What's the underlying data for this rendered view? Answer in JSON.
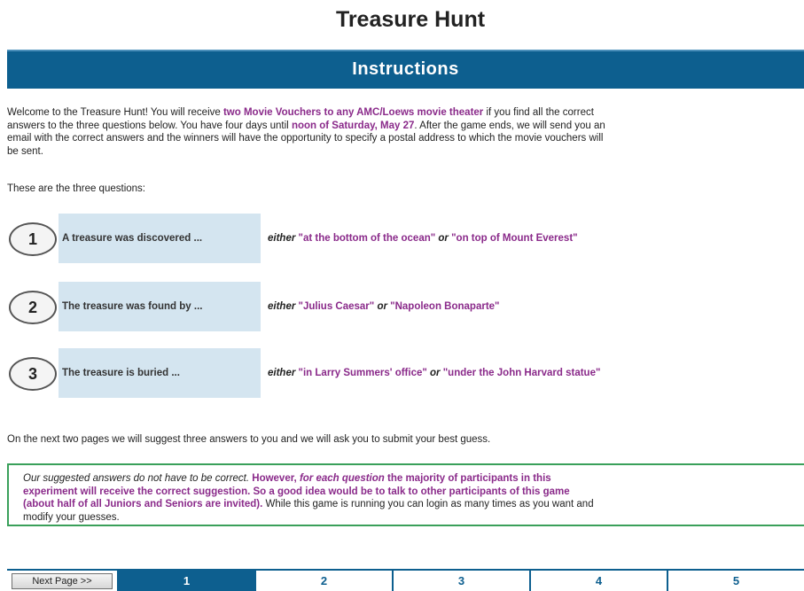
{
  "page_title": "Treasure Hunt",
  "instructions_header": "Instructions",
  "intro": {
    "l1_a": "Welcome to the Treasure Hunt! You will receive ",
    "l1_b": "two Movie Vouchers to any AMC/Loews movie theater",
    "l1_c": " if you find all the correct",
    "l2_a": "answers to the three questions below. You have four days until ",
    "l2_b": "noon of Saturday, May 27",
    "l2_c": ". After the game ends, we will send you an",
    "l3": "email with the correct answers and the winners will have the opportunity to specify a postal address to which the movie vouchers will",
    "l4": "be sent."
  },
  "questions_intro": "These are the three questions:",
  "either_label": "either",
  "or_label": "or",
  "questions": [
    {
      "number": "1",
      "text": "A treasure was discovered ...",
      "option_a": "\"at the bottom of the ocean\"",
      "option_b": "\"on top of Mount Everest\""
    },
    {
      "number": "2",
      "text": "The treasure was found by ...",
      "option_a": "\"Julius Caesar\"",
      "option_b": "\"Napoleon Bonaparte\""
    },
    {
      "number": "3",
      "text": "The treasure is buried ...",
      "option_a": "\"in Larry Summers' office\"",
      "option_b": "\"under the John Harvard statue\""
    }
  ],
  "next_pages_text": "On the next two pages we will suggest three answers to you and we will ask you to submit your best guess.",
  "notice": {
    "l1_a": "Our suggested answers do not have to be correct.",
    "l1_b": " However, ",
    "l1_c": "for each question",
    "l1_d": " the majority of participants in this",
    "l2": "experiment will receive the correct suggestion. So a good idea would be to talk to other participants of this game",
    "l3_a": "(about half of all Juniors and Seniors are invited).",
    "l3_b": " While this game is running you can login as many times as you want and",
    "l4": "modify your guesses."
  },
  "pager": {
    "next_button": "Next Page >>",
    "pages": [
      "1",
      "2",
      "3",
      "4",
      "5"
    ],
    "active_page": "1"
  },
  "colors": {
    "header_blue": "#0d5f8f",
    "question_box": "#d4e5f0",
    "highlight_purple": "#8a2a8a",
    "notice_border": "#3aa05a"
  }
}
